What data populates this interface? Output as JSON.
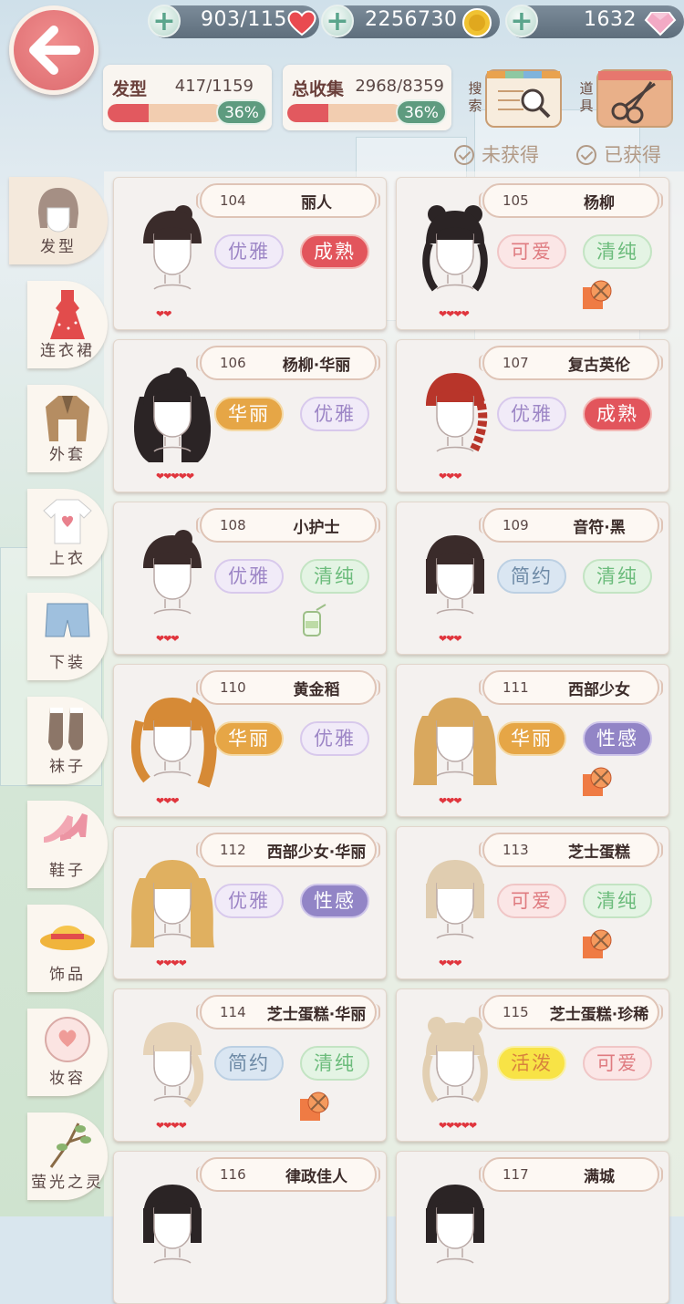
{
  "resources": [
    {
      "name": "stamina",
      "value": "903/115",
      "icon": "heart-icon",
      "color": "#e94a50"
    },
    {
      "name": "gold",
      "value": "2256730",
      "icon": "coin-icon",
      "color": "#e8b92e"
    },
    {
      "name": "diamond",
      "value": "1632",
      "icon": "diamond-icon",
      "color": "#f2a9c4"
    }
  ],
  "stats": [
    {
      "label": "发型",
      "count": "417/1159",
      "percent": "36%",
      "progress": 0.36
    },
    {
      "label": "总收集",
      "count": "2968/8359",
      "percent": "36%",
      "progress": 0.36
    }
  ],
  "tools": [
    {
      "label": "搜索",
      "icon": "magnifier-icon"
    },
    {
      "label": "道具",
      "icon": "scissors-icon"
    }
  ],
  "filters": [
    "未获得",
    "已获得"
  ],
  "categories": [
    {
      "label": "发型",
      "icon": "hair-icon",
      "active": true
    },
    {
      "label": "连衣裙",
      "icon": "dress-icon"
    },
    {
      "label": "外套",
      "icon": "coat-icon"
    },
    {
      "label": "上衣",
      "icon": "shirt-icon"
    },
    {
      "label": "下装",
      "icon": "shorts-icon"
    },
    {
      "label": "袜子",
      "icon": "socks-icon"
    },
    {
      "label": "鞋子",
      "icon": "shoes-icon"
    },
    {
      "label": "饰品",
      "icon": "hat-icon"
    },
    {
      "label": "妆容",
      "icon": "makeup-icon"
    },
    {
      "label": "萤光之灵",
      "icon": "branch-icon"
    }
  ],
  "items": [
    {
      "id": "104",
      "name": "丽人",
      "tags": [
        "优雅",
        "成熟"
      ],
      "hearts": "❤❤",
      "material": false,
      "hair": "#3a2b2a",
      "style": "bun"
    },
    {
      "id": "105",
      "name": "杨柳",
      "tags": [
        "可爱",
        "清纯"
      ],
      "hearts": "❤❤❤❤",
      "material": "yarn-icon",
      "hair": "#2b2425",
      "style": "twin"
    },
    {
      "id": "106",
      "name": "杨柳·华丽",
      "tags": [
        "华丽",
        "优雅"
      ],
      "hearts": "❤❤❤❤❤",
      "material": false,
      "hair": "#2b2425",
      "style": "long"
    },
    {
      "id": "107",
      "name": "复古英伦",
      "tags": [
        "优雅",
        "成熟"
      ],
      "hearts": "❤❤❤",
      "material": false,
      "hair": "#b8352a",
      "style": "braid"
    },
    {
      "id": "108",
      "name": "小护士",
      "tags": [
        "优雅",
        "清纯"
      ],
      "hearts": "❤❤❤",
      "material": "jar-icon",
      "hair": "#3a2b2a",
      "style": "bun"
    },
    {
      "id": "109",
      "name": "音符·黑",
      "tags": [
        "简约",
        "清纯"
      ],
      "hearts": "❤❤❤",
      "material": false,
      "hair": "#3a2b2a",
      "style": "bob"
    },
    {
      "id": "110",
      "name": "黄金稻",
      "tags": [
        "华丽",
        "优雅"
      ],
      "hearts": "❤❤❤",
      "material": false,
      "hair": "#d68a36",
      "style": "pony"
    },
    {
      "id": "111",
      "name": "西部少女",
      "tags": [
        "华丽",
        "性感"
      ],
      "hearts": "❤❤❤",
      "material": "yarn-icon",
      "hair": "#d9a85e",
      "style": "wavy"
    },
    {
      "id": "112",
      "name": "西部少女·华丽",
      "tags": [
        "优雅",
        "性感"
      ],
      "hearts": "❤❤❤❤",
      "material": false,
      "hair": "#e0b060",
      "style": "wavy"
    },
    {
      "id": "113",
      "name": "芝士蛋糕",
      "tags": [
        "可爱",
        "清纯"
      ],
      "hearts": "❤❤❤",
      "material": "yarn-icon",
      "hair": "#e0cdb0",
      "style": "bob"
    },
    {
      "id": "114",
      "name": "芝士蛋糕·华丽",
      "tags": [
        "简约",
        "清纯"
      ],
      "hearts": "❤❤❤❤",
      "material": "yarn-icon",
      "hair": "#e6d3b8",
      "style": "side"
    },
    {
      "id": "115",
      "name": "芝士蛋糕·珍稀",
      "tags": [
        "活泼",
        "可爱"
      ],
      "hearts": "❤❤❤❤❤",
      "material": false,
      "hair": "#e2cfb2",
      "style": "twin"
    },
    {
      "id": "116",
      "name": "律政佳人",
      "tags": [
        "",
        ""
      ],
      "hearts": "",
      "material": false,
      "hair": "#2b2425",
      "style": "bob"
    },
    {
      "id": "117",
      "name": "满城",
      "tags": [
        "",
        ""
      ],
      "hearts": "",
      "material": false,
      "hair": "#2b2425",
      "style": "bob"
    }
  ]
}
